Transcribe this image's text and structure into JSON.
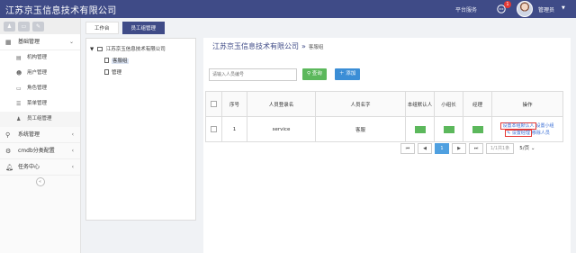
{
  "header": {
    "brand": "江苏京玉信息技术有限公司",
    "platform_label": "平台服务",
    "notification_count": "1",
    "user_name": "管理员"
  },
  "sidebar": {
    "shortcuts": [
      "♟",
      "▭",
      "✎"
    ],
    "menus": [
      {
        "label": "基础管理",
        "icon": "grid-icon"
      },
      {
        "label": "系统管理",
        "icon": "search-icon"
      },
      {
        "label": "cmdb分类配置",
        "icon": "gear-icon"
      },
      {
        "label": "任务中心",
        "icon": "bell-icon"
      }
    ],
    "sub_items": [
      {
        "label": "机构管理",
        "icon": "org-icon"
      },
      {
        "label": "用户管理",
        "icon": "users-icon"
      },
      {
        "label": "角色管理",
        "icon": "role-icon"
      },
      {
        "label": "菜单管理",
        "icon": "menu-icon"
      },
      {
        "label": "员工组管理",
        "icon": "person-icon"
      }
    ]
  },
  "tabs": [
    {
      "label": "工作台",
      "active": false
    },
    {
      "label": "员工组管理",
      "active": true
    }
  ],
  "tree": {
    "root": "江苏京玉信息技术有限公司",
    "nodes": [
      "客服组",
      "管理"
    ]
  },
  "content": {
    "title": "江苏京玉信息技术有限公司",
    "separator": "»",
    "subtitle": "客服组",
    "search_placeholder": "请输入人员编号",
    "search_button": "查询",
    "add_button": "添加",
    "table": {
      "headers": [
        "序号",
        "人员登录名",
        "人员名字",
        "本组默认人",
        "小组长",
        "经理",
        "操作"
      ],
      "rows": [
        {
          "index": "1",
          "login": "service",
          "name": "客服",
          "ops": [
            "设置本组默认人",
            "设置小组",
            "设置经理",
            "移除人员"
          ]
        }
      ]
    },
    "pager": {
      "first": "⏮",
      "prev": "◀",
      "current": "1",
      "next": "▶",
      "last": "⏭",
      "info": "1/1共1条",
      "size": "5/页"
    }
  },
  "colors": {
    "header_bg": "#3f4b87",
    "primary": "#3b8ed6",
    "success": "#5cb85c",
    "highlight_border": "#e53935"
  }
}
